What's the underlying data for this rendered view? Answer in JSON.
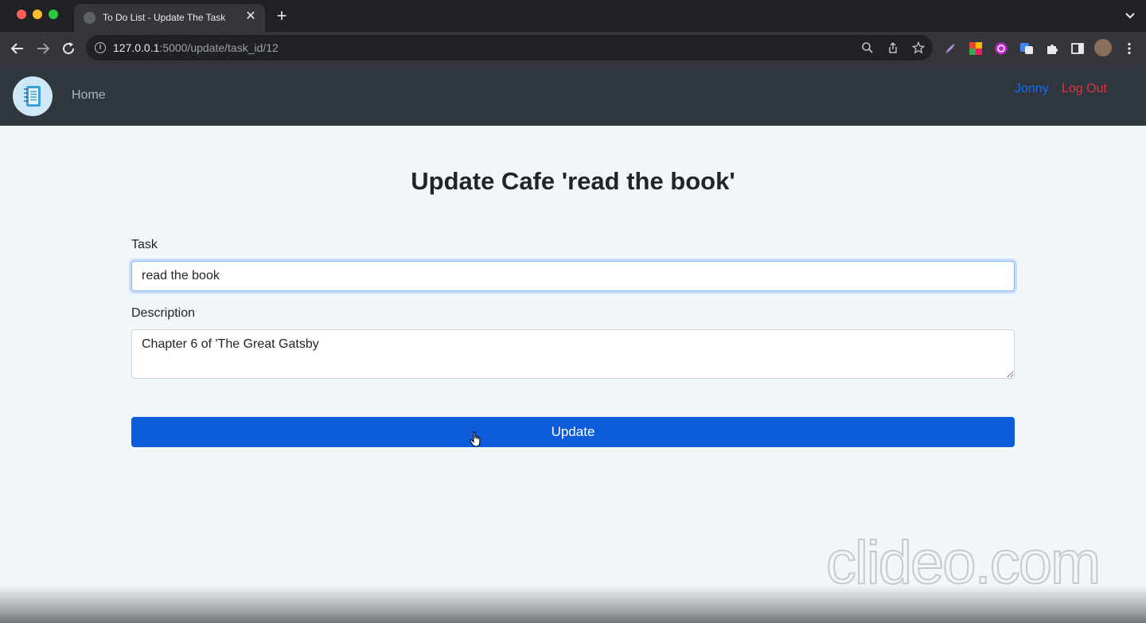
{
  "browser": {
    "tab_title": "To Do List - Update The Task",
    "tab_close": "✕",
    "new_tab": "+",
    "url_host": "127.0.0.1",
    "url_rest": ":5000/update/task_id/12",
    "info": "i"
  },
  "nav": {
    "home": "Home",
    "user": "Jonny",
    "logout": "Log Out"
  },
  "form": {
    "title": "Update Cafe 'read the book'",
    "task_label": "Task",
    "task_value": "read the book",
    "description_label": "Description",
    "description_value": "Chapter 6 of 'The Great Gatsby",
    "submit_label": "Update"
  },
  "watermark": "clideo.com",
  "colors": {
    "primary": "#0d5cdb",
    "user_link": "#0d6efd",
    "logout_link": "#dc3545",
    "navbar": "#2f363e",
    "page_bg": "#f1f6fb"
  }
}
